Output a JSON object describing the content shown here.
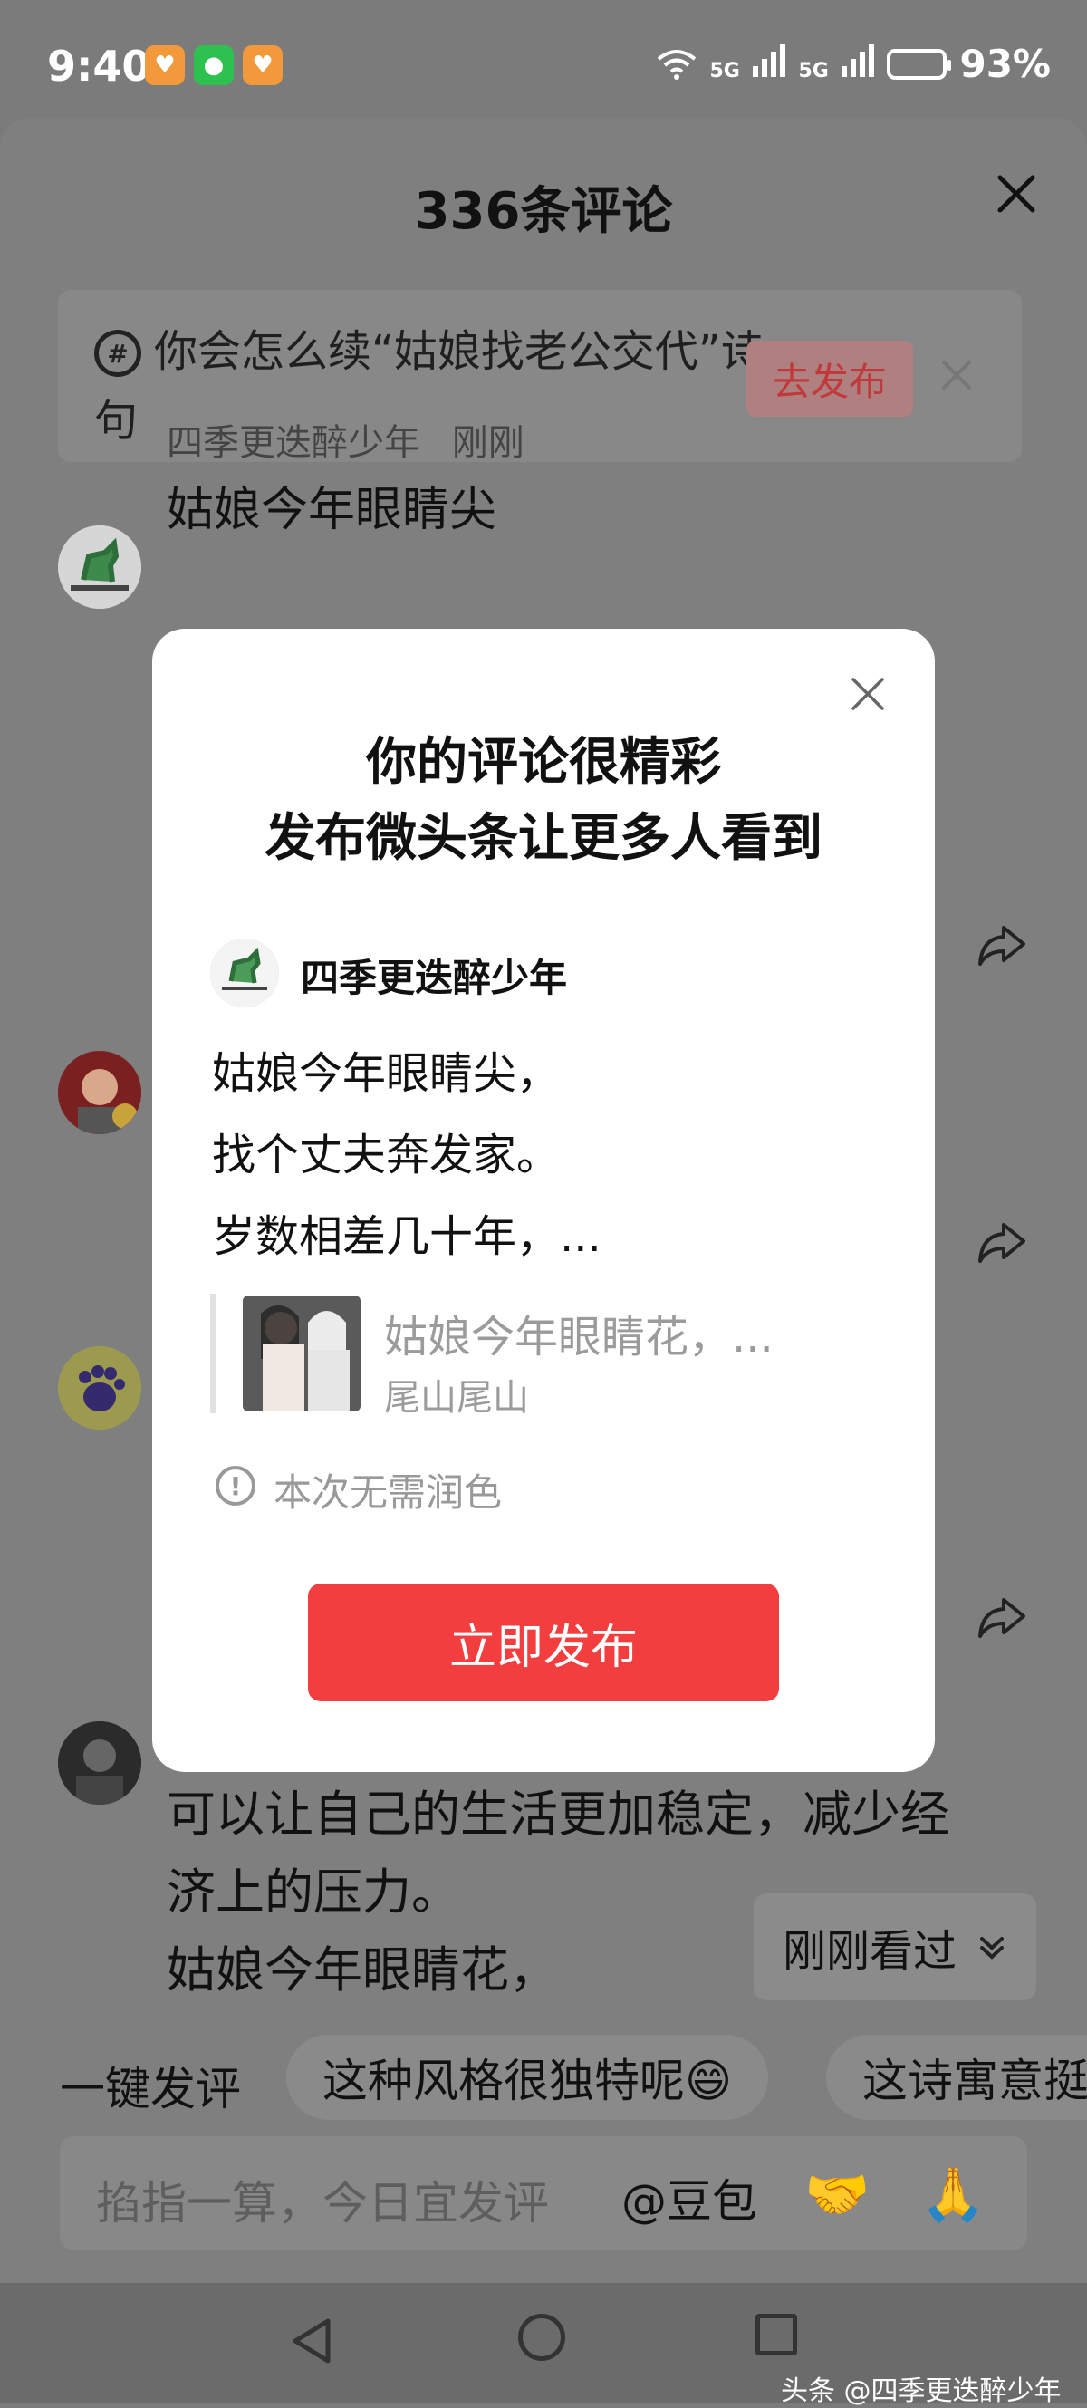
{
  "status_bar": {
    "time": "9:40",
    "network_1": "5G",
    "network_2": "5G",
    "battery": "93%"
  },
  "sheet": {
    "title": "336条评论",
    "topic": {
      "text": "你会怎么续“姑娘找老公交代”诗句",
      "button": "去发布"
    },
    "first_comment": {
      "author": "四季更迭醉少年",
      "time": "刚刚",
      "text": "姑娘今年眼睛尖"
    },
    "bottom_comment_lines": [
      "可以让自己的生活更加稳定，减少经",
      "济上的压力。",
      "姑娘今年眼睛花，"
    ],
    "recent_button": "刚刚看过"
  },
  "quick_replies": {
    "label": "一键发评",
    "chips": [
      "这种风格很独特呢😄",
      "这诗寓意挺"
    ]
  },
  "input": {
    "placeholder": "掐指一算，今日宜发评",
    "mention": "@豆包",
    "emoji_1": "🤝",
    "emoji_2": "🙏"
  },
  "modal": {
    "title_line1": "你的评论很精彩",
    "title_line2": "发布微头条让更多人看到",
    "author": "四季更迭醉少年",
    "lines": [
      "姑娘今年眼睛尖，",
      "找个丈夫奔发家。",
      "岁数相差几十年，..."
    ],
    "quote_text": "姑娘今年眼睛花，...",
    "quote_author": "尾山尾山",
    "notice": "本次无需润色",
    "publish_button": "立即发布"
  },
  "watermark": "头条 @四季更迭醉少年"
}
